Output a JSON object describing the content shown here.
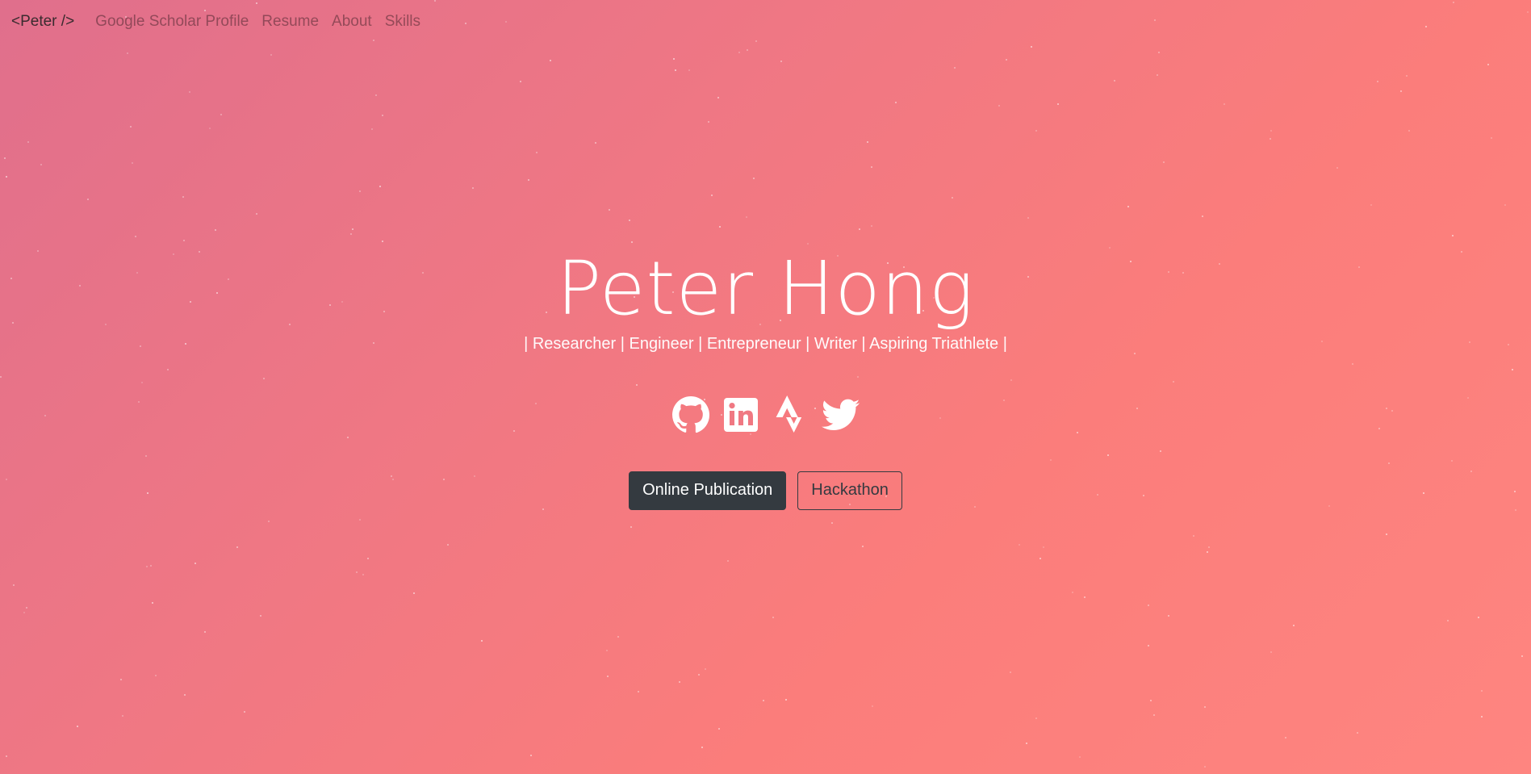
{
  "navbar": {
    "brand": "<Peter />",
    "links": [
      "Google Scholar Profile",
      "Resume",
      "About",
      "Skills"
    ]
  },
  "hero": {
    "name": "Peter Hong",
    "tagline": "| Researcher | Engineer | Entrepreneur | Writer | Aspiring Triathlete |"
  },
  "socials": [
    "github-icon",
    "linkedin-icon",
    "strava-icon",
    "twitter-icon"
  ],
  "buttons": {
    "primary": "Online Publication",
    "secondary": "Hackathon"
  },
  "colors": {
    "gradient_start": "#e06f8c",
    "gradient_end": "#fe8580",
    "button_dark": "#343a40"
  }
}
